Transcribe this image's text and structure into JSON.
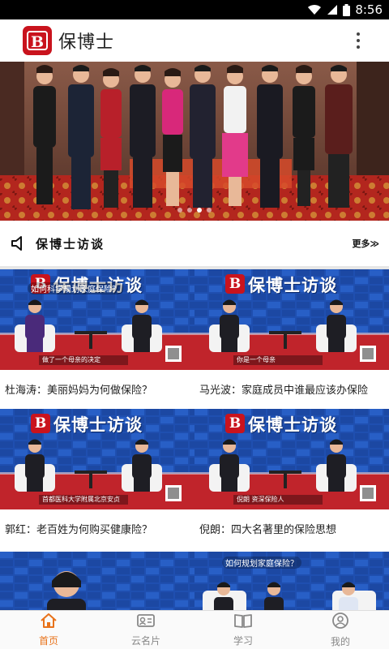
{
  "status_bar": {
    "time": "8:56"
  },
  "app": {
    "title": "保博士",
    "logo_letter": "B"
  },
  "banner": {
    "slide_count": 4,
    "active_slide": 2
  },
  "section": {
    "title": "保博士访谈",
    "more": "更多≫"
  },
  "cards": [
    {
      "caption": "杜海涛：美丽妈妈为何做保险？",
      "thumb_title": "保博士访谈",
      "subtitle": "如何科学规划家庭保险？",
      "bottom_text": "做了一个母亲的决定"
    },
    {
      "caption": "马光波：家庭成员中谁最应该办保险",
      "thumb_title": "保博士访谈",
      "subtitle": "",
      "bottom_text": "你是一个母亲"
    },
    {
      "caption": "郭红：老百姓为何购买健康险？",
      "thumb_title": "保博士访谈",
      "subtitle": "",
      "bottom_text": "首都医科大学附属北京安贞"
    },
    {
      "caption": "倪朗：四大名著里的保险思想",
      "thumb_title": "保博士访谈",
      "subtitle": "",
      "bottom_text": "倪朗 资深保险人"
    },
    {
      "caption": "",
      "thumb_title": "",
      "subtitle": "",
      "bottom_text": ""
    },
    {
      "caption": "",
      "thumb_title": "",
      "subtitle": "如何规划家庭保险？",
      "bottom_text": ""
    }
  ],
  "nav": [
    {
      "label": "首页",
      "icon": "home-icon",
      "active": true
    },
    {
      "label": "云名片",
      "icon": "business-card-icon",
      "active": false
    },
    {
      "label": "学习",
      "icon": "book-icon",
      "active": false
    },
    {
      "label": "我的",
      "icon": "profile-icon",
      "active": false
    }
  ],
  "colors": {
    "brand_red": "#c9131d",
    "active_nav": "#e8721a",
    "studio_blue": "#1f4fb0",
    "studio_red_floor": "#c0242b"
  }
}
